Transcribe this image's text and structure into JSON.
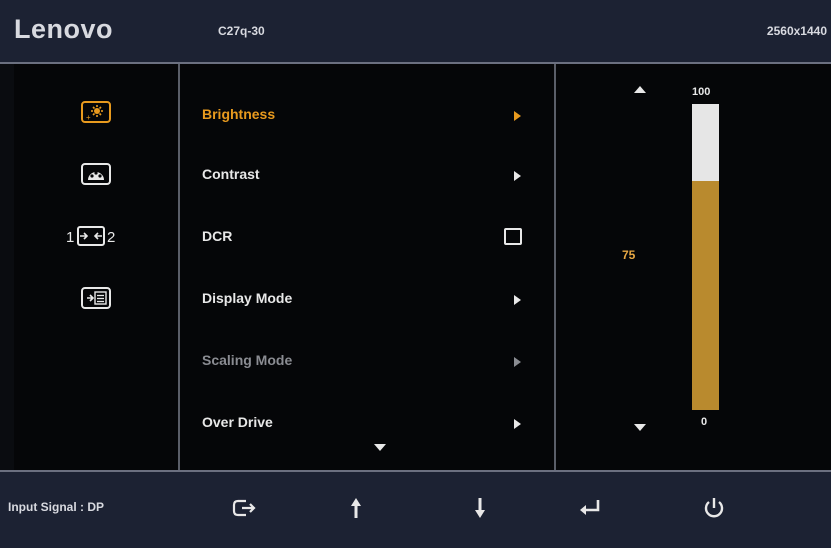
{
  "header": {
    "brand": "Lenovo",
    "model": "C27q-30",
    "resolution": "2560x1440"
  },
  "sidebar": {
    "icons": [
      {
        "name": "brightness-icon",
        "active": true
      },
      {
        "name": "color-icon",
        "active": false
      },
      {
        "name": "input-switch-icon",
        "active": false
      },
      {
        "name": "menu-settings-icon",
        "active": false
      }
    ],
    "input_icon_labels": {
      "left": "1",
      "right": "2"
    }
  },
  "menu": {
    "items": [
      {
        "label": "Brightness",
        "state": "active",
        "control": "arrow"
      },
      {
        "label": "Contrast",
        "state": "normal",
        "control": "arrow"
      },
      {
        "label": "DCR",
        "state": "normal",
        "control": "checkbox"
      },
      {
        "label": "Display Mode",
        "state": "normal",
        "control": "arrow"
      },
      {
        "label": "Scaling Mode",
        "state": "dim",
        "control": "arrow"
      },
      {
        "label": "Over Drive",
        "state": "normal",
        "control": "arrow"
      }
    ]
  },
  "value_panel": {
    "current": "75",
    "max": "100",
    "min": "0",
    "level_percent": 75
  },
  "footer": {
    "input_signal": "Input Signal : DP",
    "buttons": [
      "exit-icon",
      "arrow-up-icon",
      "arrow-down-icon",
      "enter-icon",
      "power-icon"
    ]
  },
  "colors": {
    "accent": "#e89a1e",
    "bar_fill": "#b98a2e",
    "bar_empty": "#e6e6e6",
    "panel": "#1c2233"
  }
}
